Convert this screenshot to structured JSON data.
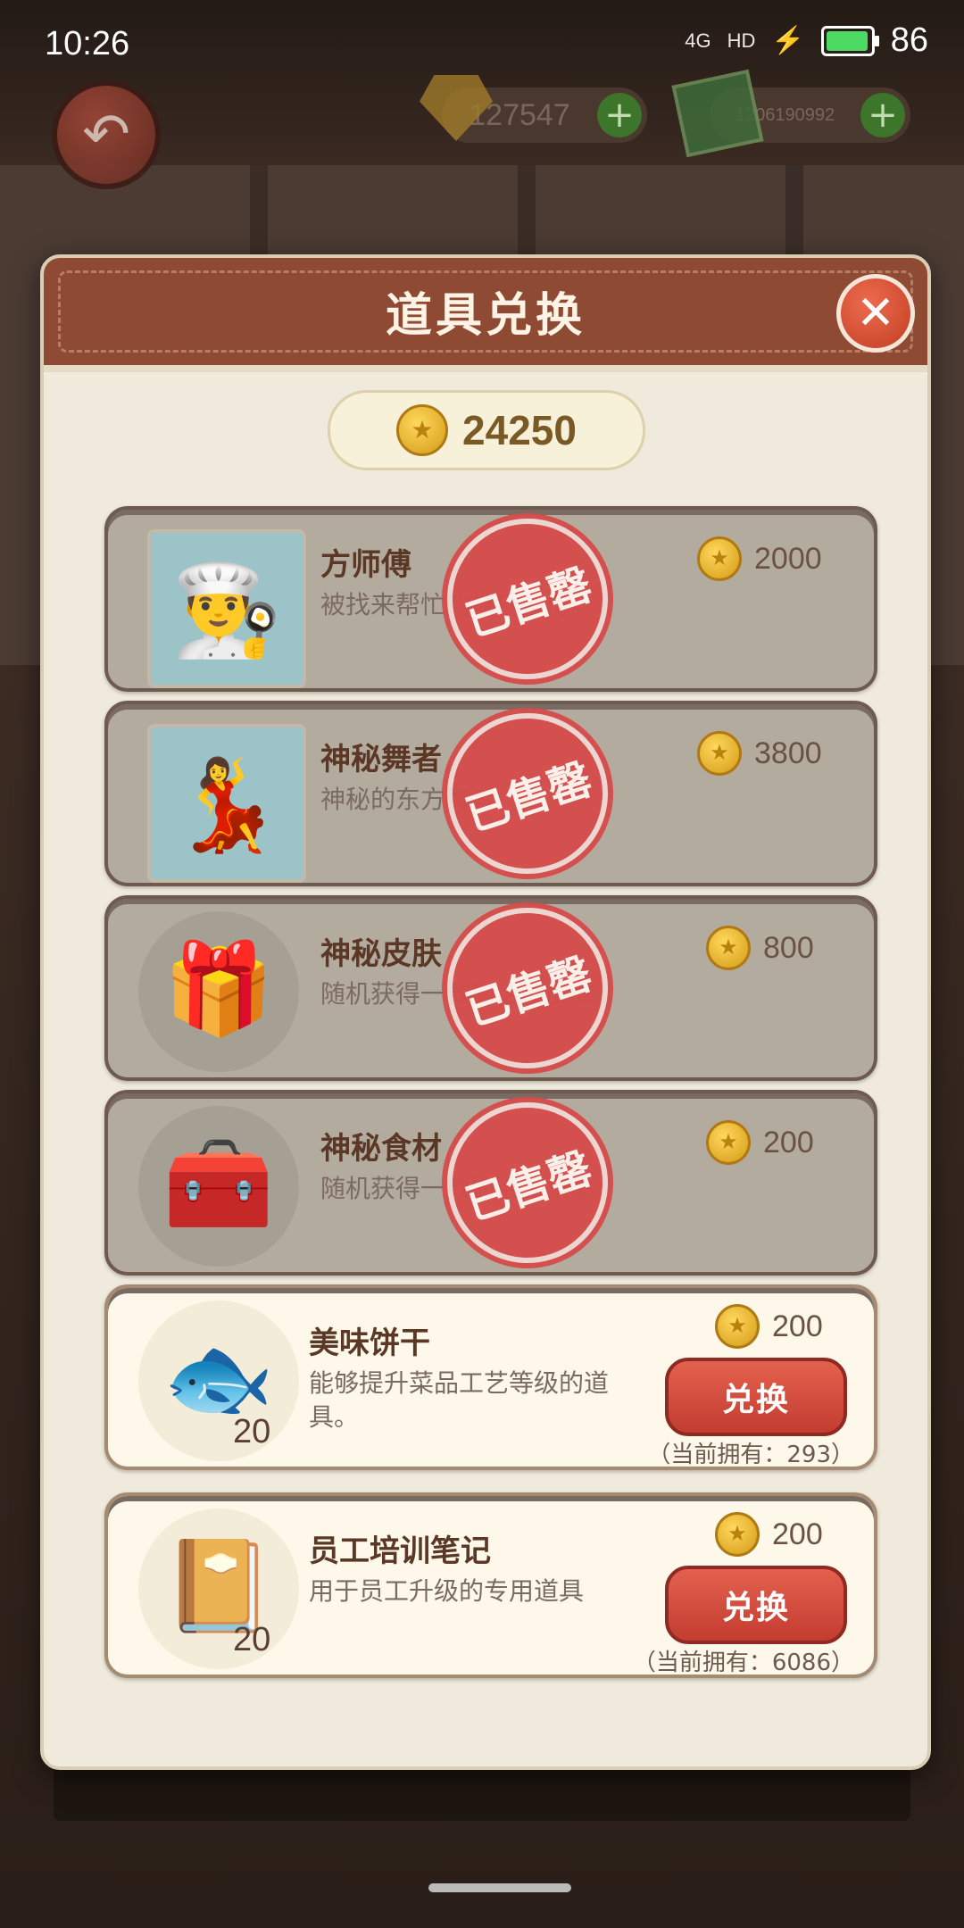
{
  "status_bar": {
    "time": "10:26",
    "network": "4G",
    "hd": "HD",
    "battery": "86"
  },
  "hud": {
    "gems": "127547",
    "cash": "1206190992",
    "plus": "+"
  },
  "modal": {
    "title": "道具兑换",
    "close": "✕",
    "balance": "24250",
    "sold_label": "已售罄",
    "exchange_label": "兑换",
    "items": [
      {
        "name": "方师傅",
        "desc": "被找来帮忙的端锅师傅。",
        "price": "2000",
        "status": "sold"
      },
      {
        "name": "神秘舞者",
        "desc": "神秘的东方舞者",
        "price": "3800",
        "status": "sold"
      },
      {
        "name": "神秘皮肤",
        "desc": "随机获得一款的活动皮肤。",
        "price": "800",
        "status": "sold"
      },
      {
        "name": "神秘食材",
        "desc": "随机获得一款的活动菜品",
        "price": "200",
        "status": "sold"
      },
      {
        "name": "美味饼干",
        "desc": "能够提升菜品工艺等级的道具。",
        "price": "200",
        "qty": "20",
        "owned": "（当前拥有：293）",
        "status": "available"
      },
      {
        "name": "员工培训笔记",
        "desc": "用于员工升级的专用道具",
        "price": "200",
        "qty": "20",
        "owned": "（当前拥有：6086）",
        "status": "available"
      }
    ]
  },
  "colors": {
    "header": "#8e4a33",
    "sold_card": "#b4ab9f",
    "stamp": "#d64c4b",
    "button": "#c23d30"
  },
  "icons": {
    "back": "back-arrow-icon",
    "gem": "gem-icon",
    "cash": "cash-icon",
    "coin": "coin-icon",
    "close": "close-icon"
  }
}
